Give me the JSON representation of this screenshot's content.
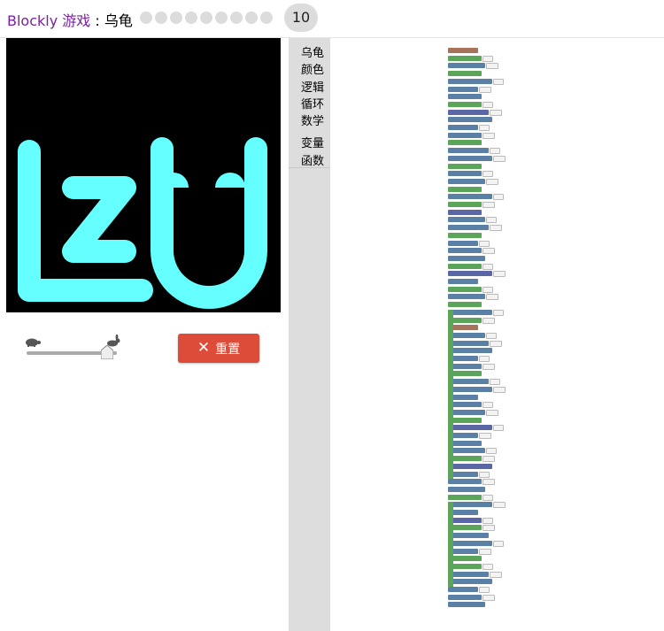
{
  "header": {
    "app_name": "Blockly 游戏",
    "separator": " : ",
    "game_name": "乌龟",
    "levels_shown": 9,
    "current_level": "10"
  },
  "canvas": {
    "background": "#000000",
    "stroke_color": "#66ffff"
  },
  "speed_slider": {
    "level_fraction": 0.95
  },
  "reset_button": {
    "label": "重置",
    "color": "#dd4b39"
  },
  "toolbox": {
    "categories": [
      "乌龟",
      "颜色",
      "逻辑",
      "循环",
      "数学"
    ],
    "categories2": [
      "变量",
      "函数"
    ]
  }
}
